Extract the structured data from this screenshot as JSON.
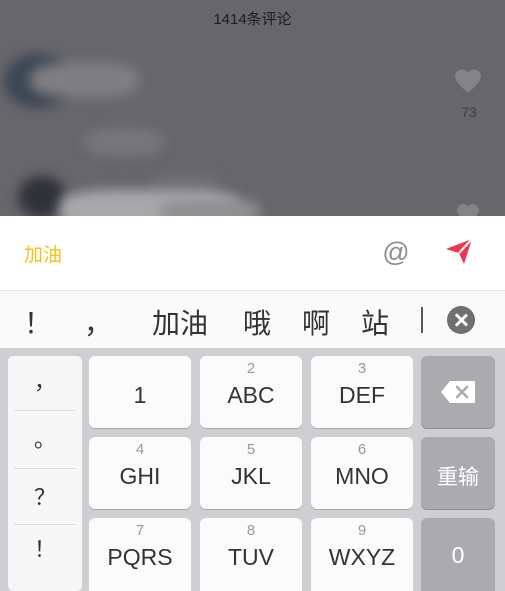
{
  "comments": {
    "title": "1414条评论",
    "like_count": "73"
  },
  "input_bar": {
    "text": "加油",
    "at_symbol": "@"
  },
  "candidates": [
    "！",
    "，",
    "加油",
    "哦",
    "啊",
    "站"
  ],
  "keyboard": {
    "punctuation": [
      "，",
      "。",
      "？",
      "！"
    ],
    "keys": [
      {
        "sub": "",
        "main": "1"
      },
      {
        "sub": "2",
        "main": "ABC"
      },
      {
        "sub": "3",
        "main": "DEF"
      },
      {
        "sub": "4",
        "main": "GHI"
      },
      {
        "sub": "5",
        "main": "JKL"
      },
      {
        "sub": "6",
        "main": "MNO"
      },
      {
        "sub": "7",
        "main": "PQRS"
      },
      {
        "sub": "8",
        "main": "TUV"
      },
      {
        "sub": "9",
        "main": "WXYZ"
      }
    ],
    "reinput_label": "重输",
    "zero_label": "0"
  },
  "colors": {
    "accent_yellow": "#f3c418",
    "send_red": "#f2324e",
    "overlay": "#67666b"
  }
}
